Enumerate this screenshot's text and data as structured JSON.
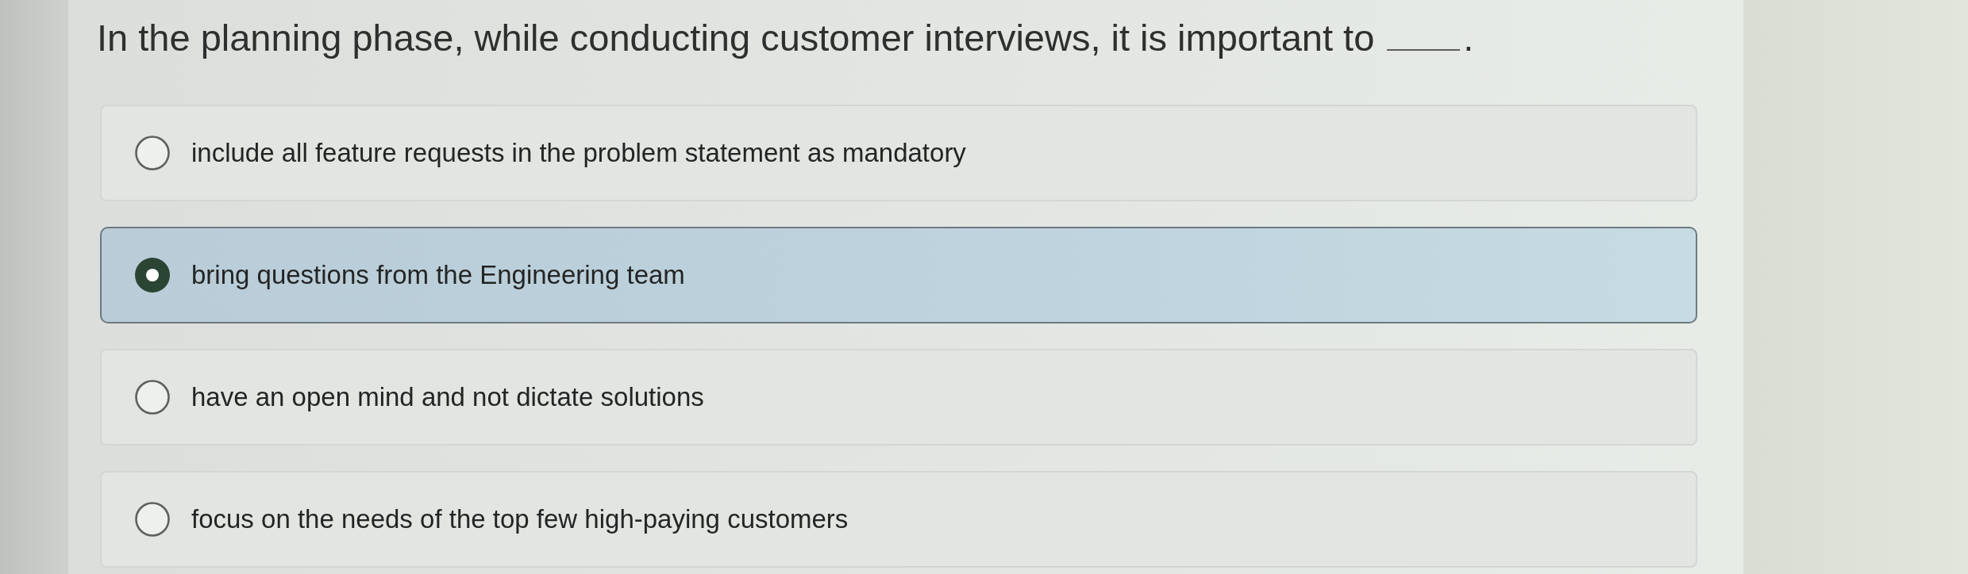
{
  "question": {
    "parts": [
      {
        "kind": "text",
        "text": "In the planning phase, while conducting customer interviews, it is important to"
      },
      {
        "kind": "blank"
      },
      {
        "kind": "text",
        "text": "."
      }
    ]
  },
  "options": [
    {
      "text": "include all feature requests in the problem statement as mandatory",
      "selected": false
    },
    {
      "text": "bring questions from the Engineering team",
      "selected": true
    },
    {
      "text": "have an open mind and not dictate solutions",
      "selected": false
    },
    {
      "text": "focus on the needs of the top few high-paying customers",
      "selected": false
    }
  ]
}
